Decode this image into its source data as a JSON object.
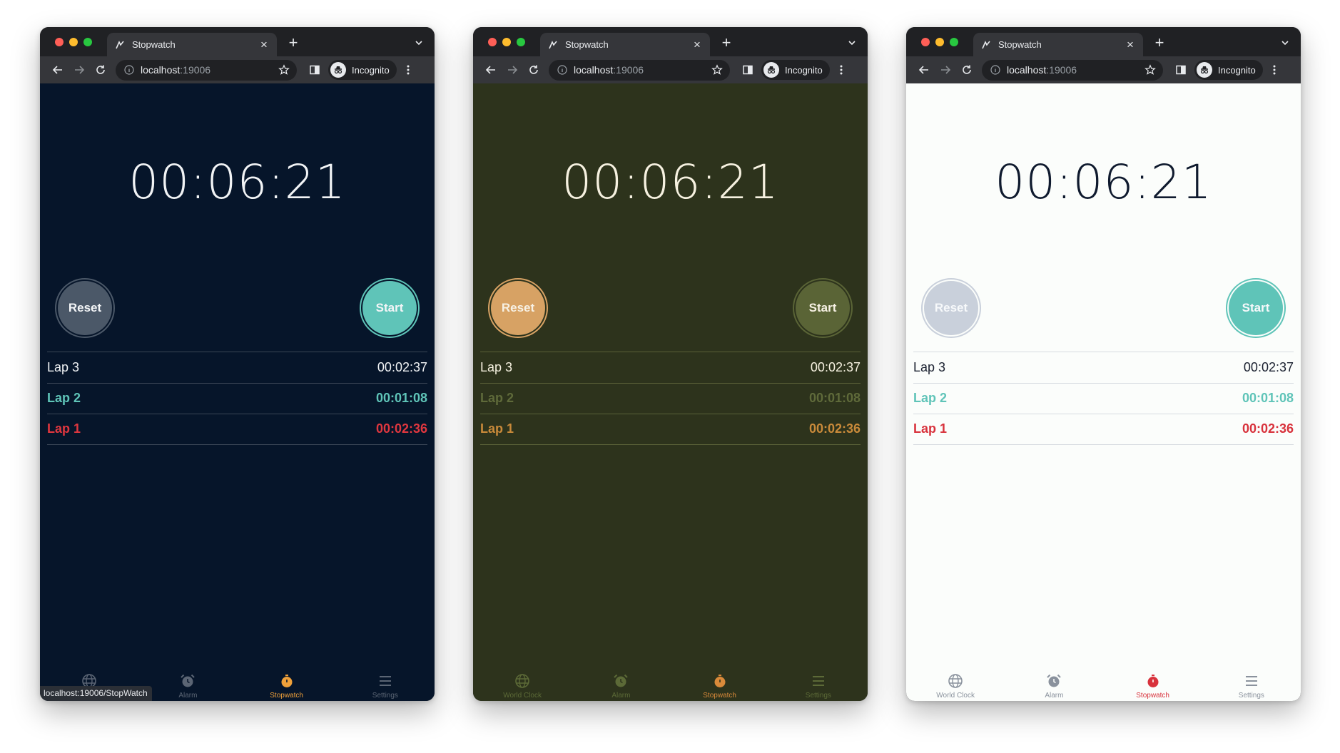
{
  "browser": {
    "tab_title": "Stopwatch",
    "url_host": "localhost",
    "url_port": ":19006",
    "profile_label": "Incognito",
    "status_url": "localhost:19006/StopWatch",
    "traffic_lights": [
      "#ff5f57",
      "#febc2e",
      "#28c840"
    ]
  },
  "stopwatch": {
    "time": "00:06:21",
    "reset_label": "Reset",
    "start_label": "Start",
    "laps": [
      {
        "name": "Lap 3",
        "time": "00:02:37",
        "kind": "normal"
      },
      {
        "name": "Lap 2",
        "time": "00:01:08",
        "kind": "best"
      },
      {
        "name": "Lap 1",
        "time": "00:02:36",
        "kind": "worst"
      }
    ]
  },
  "nav": {
    "items": [
      {
        "label": "World Clock",
        "icon": "globe-icon"
      },
      {
        "label": "Alarm",
        "icon": "alarm-clock-icon"
      },
      {
        "label": "Stopwatch",
        "icon": "stopwatch-icon"
      },
      {
        "label": "Settings",
        "icon": "menu-icon"
      }
    ],
    "active": "Stopwatch"
  },
  "themes": {
    "dark": {
      "background": "#06152a",
      "accent": "#5fc4b8",
      "danger": "#e0373f",
      "nav_active": "#f0a13a"
    },
    "olive": {
      "background": "#2d331c",
      "accent": "#d7a264",
      "secondary": "#5a6436",
      "nav_active": "#d98a3a"
    },
    "light": {
      "background": "#fbfdfb",
      "accent": "#5fc4b8",
      "danger": "#d8323c",
      "nav_active": "#d8323c"
    }
  }
}
